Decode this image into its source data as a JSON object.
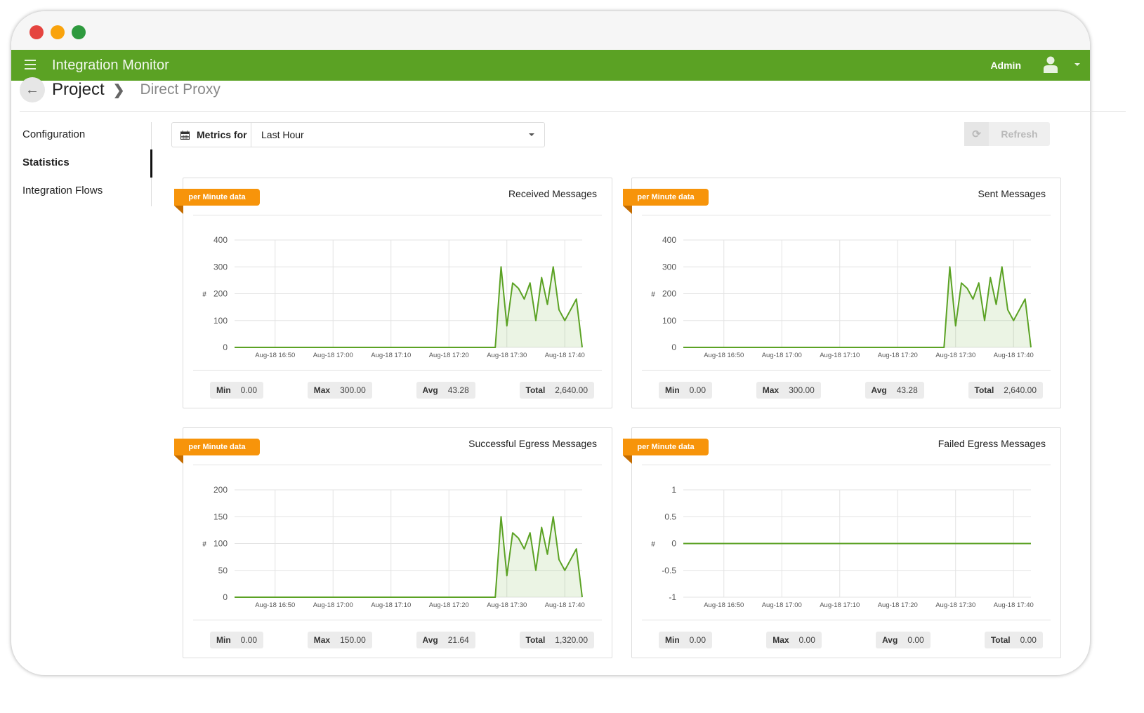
{
  "app": {
    "title": "Integration Monitor",
    "user": "Admin"
  },
  "breadcrumb": {
    "parent": "Project",
    "current": "Direct Proxy"
  },
  "sidebar": {
    "items": [
      {
        "label": "Configuration"
      },
      {
        "label": "Statistics",
        "active": true
      },
      {
        "label": "Integration Flows"
      }
    ]
  },
  "toolbar": {
    "metrics_label": "Metrics for",
    "range": "Last Hour",
    "refresh": "Refresh"
  },
  "colors": {
    "brand": "#5ba224",
    "ribbon": "#f7940a",
    "line": "#5ba224"
  },
  "panels": [
    {
      "badge": "per Minute data",
      "title": "Received Messages",
      "stats": {
        "min_label": "Min",
        "min": "0.00",
        "max_label": "Max",
        "max": "300.00",
        "avg_label": "Avg",
        "avg": "43.28",
        "total_label": "Total",
        "total": "2,640.00"
      }
    },
    {
      "badge": "per Minute data",
      "title": "Sent Messages",
      "stats": {
        "min_label": "Min",
        "min": "0.00",
        "max_label": "Max",
        "max": "300.00",
        "avg_label": "Avg",
        "avg": "43.28",
        "total_label": "Total",
        "total": "2,640.00"
      }
    },
    {
      "badge": "per Minute data",
      "title": "Successful Egress Messages",
      "stats": {
        "min_label": "Min",
        "min": "0.00",
        "max_label": "Max",
        "max": "150.00",
        "avg_label": "Avg",
        "avg": "21.64",
        "total_label": "Total",
        "total": "1,320.00"
      }
    },
    {
      "badge": "per Minute data",
      "title": "Failed Egress Messages",
      "stats": {
        "min_label": "Min",
        "min": "0.00",
        "max_label": "Max",
        "max": "0.00",
        "avg_label": "Avg",
        "avg": "0.00",
        "total_label": "Total",
        "total": "0.00"
      }
    }
  ],
  "chart_data": [
    {
      "type": "area",
      "title": "Received Messages",
      "ylabel": "#",
      "x_range": [
        "Aug-18 16:43",
        "Aug-18 17:43"
      ],
      "x_step_minutes": 1,
      "xticks": [
        "Aug-18 16:50",
        "Aug-18 17:00",
        "Aug-18 17:10",
        "Aug-18 17:20",
        "Aug-18 17:30",
        "Aug-18 17:40"
      ],
      "yticks": [
        "0",
        "100",
        "200",
        "300",
        "400"
      ],
      "ylim": [
        0,
        400
      ],
      "grid": true,
      "values": [
        0,
        0,
        0,
        0,
        0,
        0,
        0,
        0,
        0,
        0,
        0,
        0,
        0,
        0,
        0,
        0,
        0,
        0,
        0,
        0,
        0,
        0,
        0,
        0,
        0,
        0,
        0,
        0,
        0,
        0,
        0,
        0,
        0,
        0,
        0,
        0,
        0,
        0,
        0,
        0,
        0,
        0,
        0,
        0,
        0,
        0,
        300,
        80,
        240,
        220,
        180,
        240,
        100,
        260,
        160,
        300,
        140,
        100,
        140,
        180,
        0
      ]
    },
    {
      "type": "area",
      "title": "Sent Messages",
      "ylabel": "#",
      "x_range": [
        "Aug-18 16:43",
        "Aug-18 17:43"
      ],
      "x_step_minutes": 1,
      "xticks": [
        "Aug-18 16:50",
        "Aug-18 17:00",
        "Aug-18 17:10",
        "Aug-18 17:20",
        "Aug-18 17:30",
        "Aug-18 17:40"
      ],
      "yticks": [
        "0",
        "100",
        "200",
        "300",
        "400"
      ],
      "ylim": [
        0,
        400
      ],
      "grid": true,
      "values": [
        0,
        0,
        0,
        0,
        0,
        0,
        0,
        0,
        0,
        0,
        0,
        0,
        0,
        0,
        0,
        0,
        0,
        0,
        0,
        0,
        0,
        0,
        0,
        0,
        0,
        0,
        0,
        0,
        0,
        0,
        0,
        0,
        0,
        0,
        0,
        0,
        0,
        0,
        0,
        0,
        0,
        0,
        0,
        0,
        0,
        0,
        300,
        80,
        240,
        220,
        180,
        240,
        100,
        260,
        160,
        300,
        140,
        100,
        140,
        180,
        0
      ]
    },
    {
      "type": "area",
      "title": "Successful Egress Messages",
      "ylabel": "#",
      "x_range": [
        "Aug-18 16:43",
        "Aug-18 17:43"
      ],
      "x_step_minutes": 1,
      "xticks": [
        "Aug-18 16:50",
        "Aug-18 17:00",
        "Aug-18 17:10",
        "Aug-18 17:20",
        "Aug-18 17:30",
        "Aug-18 17:40"
      ],
      "yticks": [
        "0",
        "50",
        "100",
        "150",
        "200"
      ],
      "ylim": [
        0,
        200
      ],
      "grid": true,
      "values": [
        0,
        0,
        0,
        0,
        0,
        0,
        0,
        0,
        0,
        0,
        0,
        0,
        0,
        0,
        0,
        0,
        0,
        0,
        0,
        0,
        0,
        0,
        0,
        0,
        0,
        0,
        0,
        0,
        0,
        0,
        0,
        0,
        0,
        0,
        0,
        0,
        0,
        0,
        0,
        0,
        0,
        0,
        0,
        0,
        0,
        0,
        150,
        40,
        120,
        110,
        90,
        120,
        50,
        130,
        80,
        150,
        70,
        50,
        70,
        90,
        0
      ]
    },
    {
      "type": "line",
      "title": "Failed Egress Messages",
      "ylabel": "#",
      "x_range": [
        "Aug-18 16:43",
        "Aug-18 17:43"
      ],
      "x_step_minutes": 1,
      "xticks": [
        "Aug-18 16:50",
        "Aug-18 17:00",
        "Aug-18 17:10",
        "Aug-18 17:20",
        "Aug-18 17:30",
        "Aug-18 17:40"
      ],
      "yticks": [
        "-1",
        "-0.5",
        "0",
        "0.5",
        "1"
      ],
      "ylim": [
        -1,
        1
      ],
      "grid": true,
      "values": [
        0,
        0,
        0,
        0,
        0,
        0,
        0,
        0,
        0,
        0,
        0,
        0,
        0,
        0,
        0,
        0,
        0,
        0,
        0,
        0,
        0,
        0,
        0,
        0,
        0,
        0,
        0,
        0,
        0,
        0,
        0,
        0,
        0,
        0,
        0,
        0,
        0,
        0,
        0,
        0,
        0,
        0,
        0,
        0,
        0,
        0,
        0,
        0,
        0,
        0,
        0,
        0,
        0,
        0,
        0,
        0,
        0,
        0,
        0,
        0,
        0
      ]
    }
  ]
}
